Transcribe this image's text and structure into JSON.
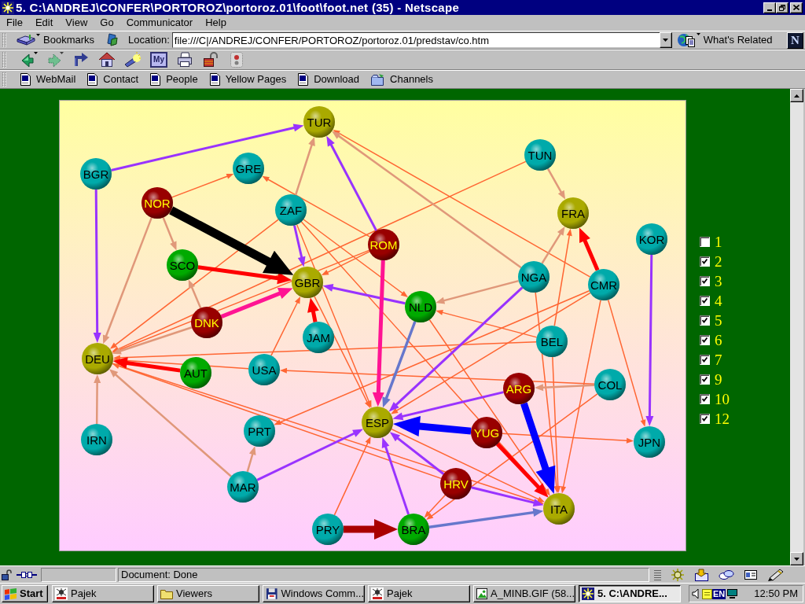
{
  "window": {
    "title": "5. C:\\ANDREJ\\CONFER\\PORTOROZ\\portoroz.01\\foot\\foot.net (35) - Netscape"
  },
  "menu": [
    "File",
    "Edit",
    "View",
    "Go",
    "Communicator",
    "Help"
  ],
  "location_toolbar": {
    "bookmarks": "Bookmarks",
    "location_label": "Location:",
    "url": "file:///C|/ANDREJ/CONFER/PORTOROZ/portoroz.01/predstav/co.htm",
    "whats_related": "What's Related",
    "logo": "N"
  },
  "navigation_toolbar": {
    "my_button": "My"
  },
  "personal_toolbar": [
    {
      "label": "WebMail",
      "kind": "page"
    },
    {
      "label": "Contact",
      "kind": "page"
    },
    {
      "label": "People",
      "kind": "page"
    },
    {
      "label": "Yellow Pages",
      "kind": "page"
    },
    {
      "label": "Download",
      "kind": "page"
    },
    {
      "label": "Channels",
      "kind": "folder"
    }
  ],
  "graph": {
    "nodes": [
      {
        "label": "TUR",
        "color": "#aaaa00"
      },
      {
        "label": "BGR",
        "color": "#00aaaa"
      },
      {
        "label": "GRE",
        "color": "#00aaaa"
      },
      {
        "label": "NOR",
        "color": "#990000"
      },
      {
        "label": "ZAF",
        "color": "#00aaaa"
      },
      {
        "label": "TUN",
        "color": "#00aaaa"
      },
      {
        "label": "FRA",
        "color": "#aaaa00"
      },
      {
        "label": "KOR",
        "color": "#00aaaa"
      },
      {
        "label": "ROM",
        "color": "#990000"
      },
      {
        "label": "SCO",
        "color": "#00aa00"
      },
      {
        "label": "GBR",
        "color": "#aaaa00"
      },
      {
        "label": "NGA",
        "color": "#00aaaa"
      },
      {
        "label": "CMR",
        "color": "#00aaaa"
      },
      {
        "label": "NLD",
        "color": "#00aa00"
      },
      {
        "label": "DNK",
        "color": "#990000"
      },
      {
        "label": "JAM",
        "color": "#00aaaa"
      },
      {
        "label": "BEL",
        "color": "#00aaaa"
      },
      {
        "label": "DEU",
        "color": "#aaaa00"
      },
      {
        "label": "AUT",
        "color": "#00aa00"
      },
      {
        "label": "USA",
        "color": "#00aaaa"
      },
      {
        "label": "ARG",
        "color": "#990000"
      },
      {
        "label": "COL",
        "color": "#00aaaa"
      },
      {
        "label": "ESP",
        "color": "#aaaa00"
      },
      {
        "label": "YUG",
        "color": "#990000"
      },
      {
        "label": "IRN",
        "color": "#00aaaa"
      },
      {
        "label": "PRT",
        "color": "#00aaaa"
      },
      {
        "label": "JPN",
        "color": "#00aaaa"
      },
      {
        "label": "MAR",
        "color": "#00aaaa"
      },
      {
        "label": "HRV",
        "color": "#990000"
      },
      {
        "label": "ITA",
        "color": "#aaaa00"
      },
      {
        "label": "PRY",
        "color": "#00aaaa"
      },
      {
        "label": "BRA",
        "color": "#00aa00"
      }
    ]
  },
  "legend": [
    {
      "label": "1",
      "checked": false
    },
    {
      "label": "2",
      "checked": true
    },
    {
      "label": "3",
      "checked": true
    },
    {
      "label": "4",
      "checked": true
    },
    {
      "label": "5",
      "checked": true
    },
    {
      "label": "6",
      "checked": true
    },
    {
      "label": "7",
      "checked": true
    },
    {
      "label": "9",
      "checked": true
    },
    {
      "label": "10",
      "checked": true
    },
    {
      "label": "12",
      "checked": true
    }
  ],
  "status_bar": {
    "text": "Document: Done"
  },
  "taskbar": {
    "start": "Start",
    "tasks": [
      {
        "label": "Pajek",
        "kind": "spider",
        "selected": false
      },
      {
        "label": "Viewers",
        "kind": "folder",
        "selected": false
      },
      {
        "label": "Windows Comm...",
        "kind": "disk",
        "selected": false
      },
      {
        "label": "Pajek",
        "kind": "spider",
        "selected": false
      },
      {
        "label": "A_MINB.GIF (58...",
        "kind": "image",
        "selected": false
      },
      {
        "label": "5. C:\\ANDRE...",
        "kind": "star",
        "selected": true
      }
    ],
    "tray": {
      "language": "EN",
      "clock": "12:50 PM"
    }
  }
}
